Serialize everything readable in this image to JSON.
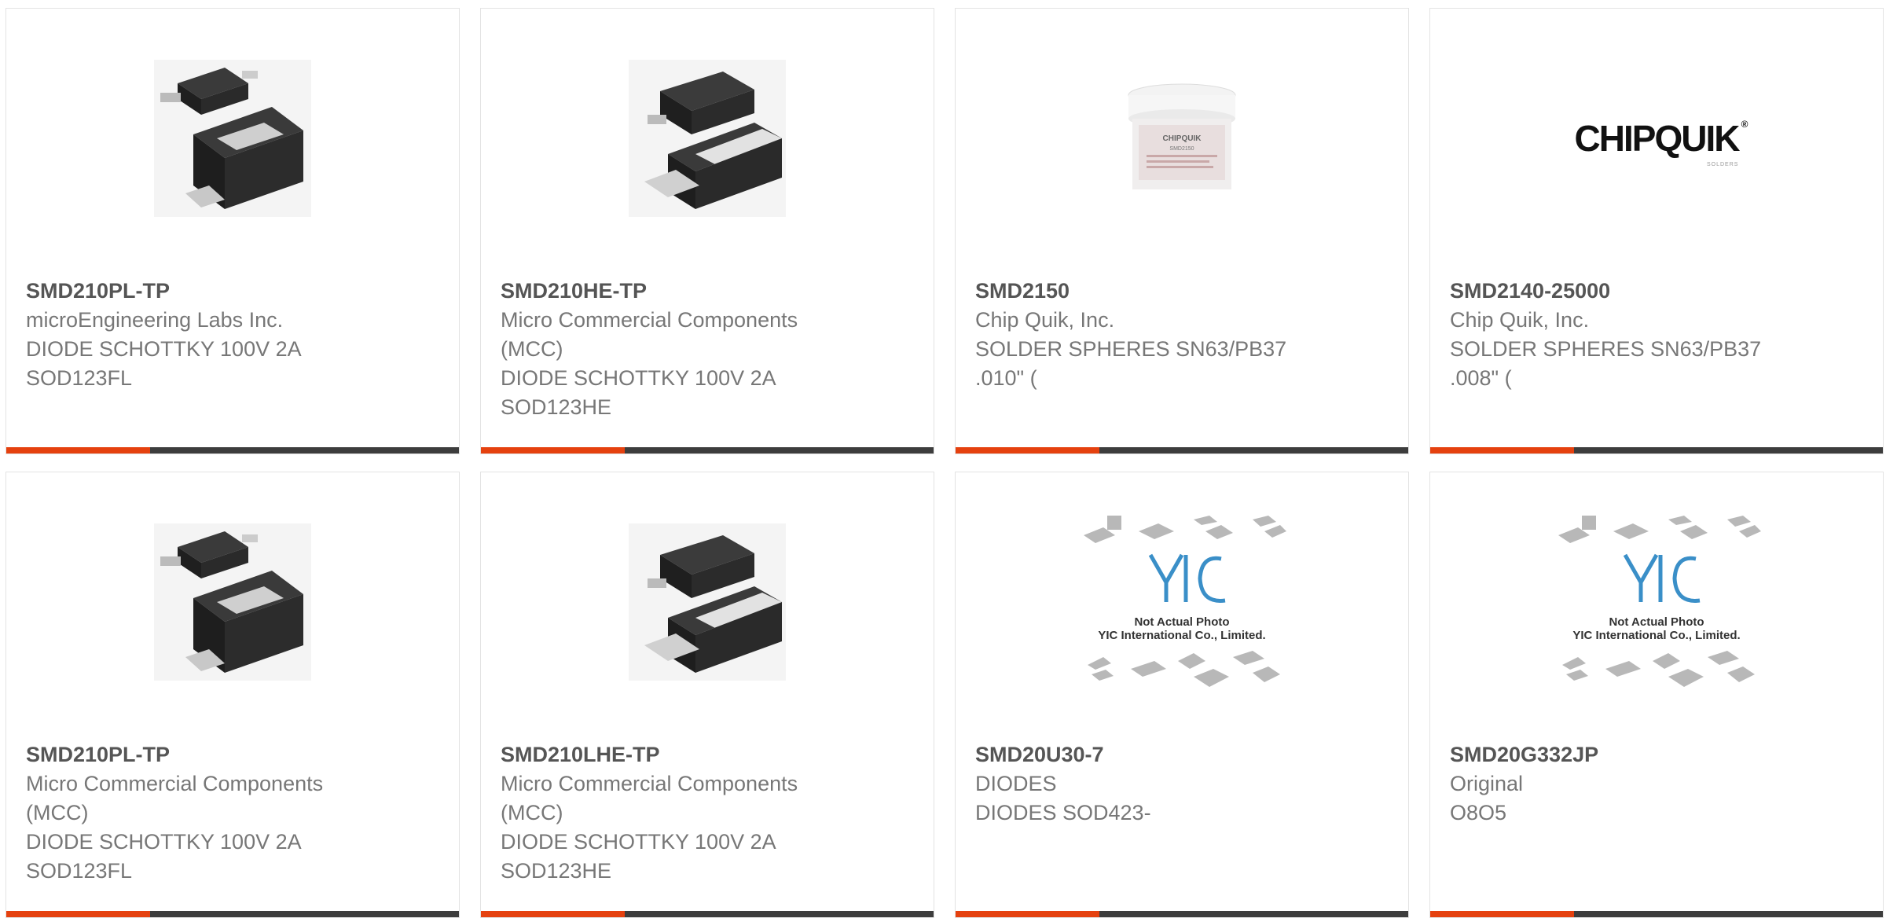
{
  "products": [
    {
      "part": "SMD210PL-TP",
      "manufacturer": "microEngineering Labs Inc.",
      "description": "DIODE SCHOTTKY 100V 2A\nSOD123FL",
      "image": "diode-sod123fl-image"
    },
    {
      "part": "SMD210HE-TP",
      "manufacturer": "Micro Commercial Components\n(MCC)",
      "description": "DIODE SCHOTTKY 100V 2A\nSOD123HE",
      "image": "diode-sod123he-image"
    },
    {
      "part": "SMD2150",
      "manufacturer": "Chip Quik, Inc.",
      "description": "SOLDER SPHERES SN63/PB37\n.010\" (",
      "image": "solder-jar-image",
      "jar_brand": "CHIPQUIK",
      "jar_code": "SMD2150"
    },
    {
      "part": "SMD2140-25000",
      "manufacturer": "Chip Quik, Inc.",
      "description": "SOLDER SPHERES SN63/PB37\n.008\" (",
      "image": "chipquik-logo-image",
      "logo_text": "CHIPQUIK",
      "logo_sub": "SOLDERS"
    },
    {
      "part": "SMD210PL-TP",
      "manufacturer": "Micro Commercial Components\n(MCC)",
      "description": "DIODE SCHOTTKY 100V 2A\nSOD123FL",
      "image": "diode-sod123fl-image"
    },
    {
      "part": "SMD210LHE-TP",
      "manufacturer": "Micro Commercial Components\n(MCC)",
      "description": "DIODE SCHOTTKY 100V 2A\nSOD123HE",
      "image": "diode-sod123he-image"
    },
    {
      "part": "SMD20U30-7",
      "manufacturer": "DIODES",
      "description": "DIODES SOD423-",
      "image": "yic-placeholder-image",
      "placeholder_line1": "Not Actual Photo",
      "placeholder_line2": "YIC International Co., Limited.",
      "placeholder_logo": "YIC"
    },
    {
      "part": "SMD20G332JP",
      "manufacturer": "Original",
      "description": "O8O5",
      "image": "yic-placeholder-image",
      "placeholder_line1": "Not Actual Photo",
      "placeholder_line2": "YIC International Co., Limited.",
      "placeholder_logo": "YIC"
    }
  ],
  "colors": {
    "accent": "#e5410f",
    "bar": "#3d3d3d",
    "title": "#555555",
    "text": "#777777",
    "border": "#e3e3e3"
  }
}
